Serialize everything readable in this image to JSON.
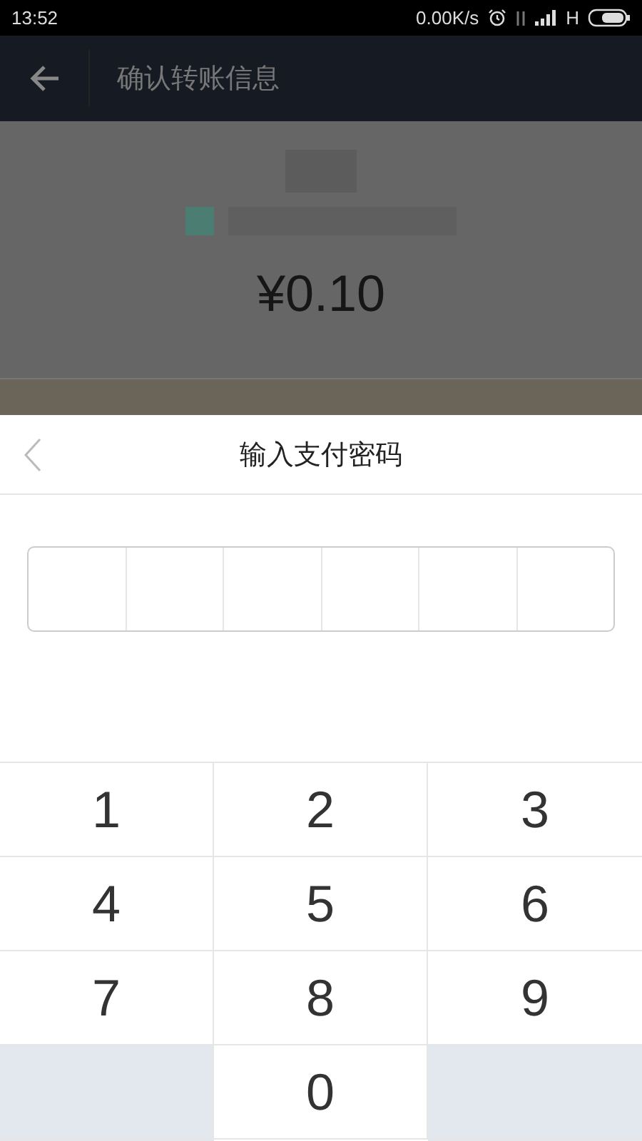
{
  "status_bar": {
    "time": "13:52",
    "net_speed": "0.00K/s",
    "network": "H"
  },
  "header": {
    "title": "确认转账信息"
  },
  "transfer": {
    "amount": "¥0.10"
  },
  "sheet": {
    "title": "输入支付密码",
    "digits": [
      {
        "filled": false
      },
      {
        "filled": false
      },
      {
        "filled": false
      },
      {
        "filled": false
      },
      {
        "filled": false
      },
      {
        "filled": false
      }
    ]
  },
  "keypad": [
    {
      "kind": "digit",
      "label": "1"
    },
    {
      "kind": "digit",
      "label": "2"
    },
    {
      "kind": "digit",
      "label": "3"
    },
    {
      "kind": "digit",
      "label": "4"
    },
    {
      "kind": "digit",
      "label": "5"
    },
    {
      "kind": "digit",
      "label": "6"
    },
    {
      "kind": "digit",
      "label": "7"
    },
    {
      "kind": "digit",
      "label": "8"
    },
    {
      "kind": "digit",
      "label": "9"
    },
    {
      "kind": "blank"
    },
    {
      "kind": "digit",
      "label": "0"
    },
    {
      "kind": "blank"
    }
  ]
}
